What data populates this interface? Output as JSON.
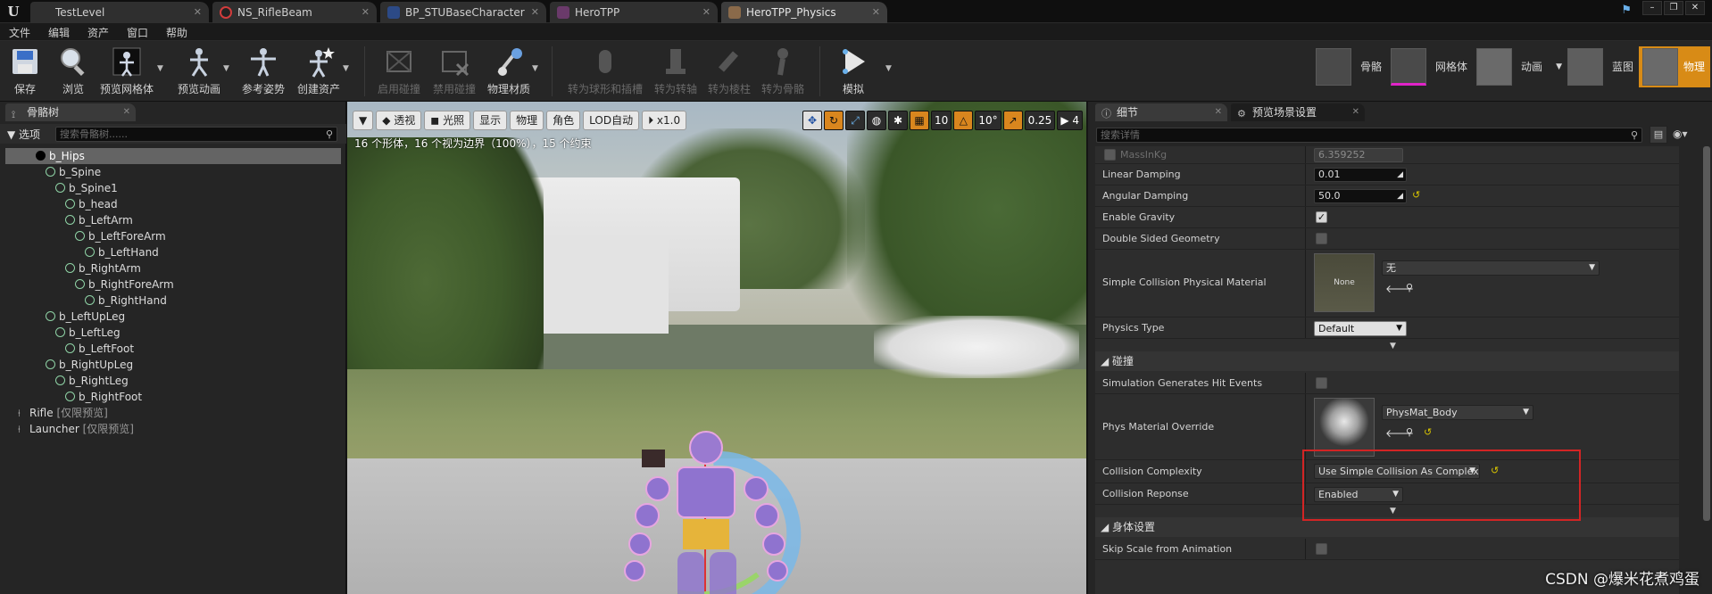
{
  "tabs": [
    {
      "label": "TestLevel"
    },
    {
      "label": "NS_RifleBeam"
    },
    {
      "label": "BP_STUBaseCharacter"
    },
    {
      "label": "HeroTPP"
    },
    {
      "label": "HeroTPP_Physics"
    }
  ],
  "menu": [
    "文件",
    "编辑",
    "资产",
    "窗口",
    "帮助"
  ],
  "toolbar": {
    "save": "保存",
    "browse": "浏览",
    "preview_mesh": "预览网格体",
    "preview_anim": "预览动画",
    "ref_pose": "参考姿势",
    "create_asset": "创建资产",
    "enable_collision": "启用碰撞",
    "disable_collision": "禁用碰撞",
    "phys_material": "物理材质",
    "to_sphyl": "转为球形和插槽",
    "to_axis": "转为转轴",
    "to_pillar": "转为棱柱",
    "to_bone": "转为骨骼",
    "simulate": "模拟"
  },
  "modes": {
    "skeleton": "骨骼",
    "mesh": "网格体",
    "animation": "动画",
    "blueprint": "蓝图",
    "physics": "物理"
  },
  "left_panel": {
    "tab": "骨骼树",
    "options": "选项",
    "search_placeholder": "搜索骨骼树......",
    "bones": [
      {
        "name": "b_Hips",
        "depth": 0,
        "root": true
      },
      {
        "name": "b_Spine",
        "depth": 1
      },
      {
        "name": "b_Spine1",
        "depth": 2
      },
      {
        "name": "b_head",
        "depth": 3
      },
      {
        "name": "b_LeftArm",
        "depth": 3
      },
      {
        "name": "b_LeftForeArm",
        "depth": 4
      },
      {
        "name": "b_LeftHand",
        "depth": 5
      },
      {
        "name": "b_RightArm",
        "depth": 3
      },
      {
        "name": "b_RightForeArm",
        "depth": 4
      },
      {
        "name": "b_RightHand",
        "depth": 5
      },
      {
        "name": "b_LeftUpLeg",
        "depth": 1
      },
      {
        "name": "b_LeftLeg",
        "depth": 2
      },
      {
        "name": "b_LeftFoot",
        "depth": 3
      },
      {
        "name": "b_RightUpLeg",
        "depth": 1
      },
      {
        "name": "b_RightLeg",
        "depth": 2
      },
      {
        "name": "b_RightFoot",
        "depth": 3
      }
    ],
    "sockets": [
      {
        "name": "Rifle",
        "suffix": "[仅限预览]"
      },
      {
        "name": "Launcher",
        "suffix": "[仅限预览]"
      }
    ]
  },
  "viewport": {
    "perspective": "透视",
    "lit": "光照",
    "show": "显示",
    "physics": "物理",
    "character": "角色",
    "lod": "LOD自动",
    "speed": "x1.0",
    "info": "16 个形体，16 个视为边界（100%），15 个约束",
    "grid_snap": "10",
    "rot_snap": "10°",
    "scale_snap": "0.25",
    "cam_speed": "4"
  },
  "right_panel": {
    "tab_details": "细节",
    "tab_preview": "预览场景设置",
    "search_placeholder": "搜索详情",
    "mass_label": "MassInKg",
    "mass_value": "6.359252",
    "linear_damping_label": "Linear Damping",
    "linear_damping_value": "0.01",
    "angular_damping_label": "Angular Damping",
    "angular_damping_value": "50.0",
    "enable_gravity_label": "Enable Gravity",
    "double_sided_label": "Double Sided Geometry",
    "simple_coll_mat_label": "Simple Collision Physical Material",
    "simple_coll_mat_thumb": "None",
    "simple_coll_mat_value": "无",
    "physics_type_label": "Physics Type",
    "physics_type_value": "Default",
    "section_collision": "碰撞",
    "sim_hit_label": "Simulation Generates Hit Events",
    "phys_mat_override_label": "Phys Material Override",
    "phys_mat_override_value": "PhysMat_Body",
    "coll_complexity_label": "Collision Complexity",
    "coll_complexity_value": "Use Simple Collision As Complex",
    "coll_response_label": "Collision Reponse",
    "coll_response_value": "Enabled",
    "section_body": "身体设置",
    "skip_scale_label": "Skip Scale from Animation"
  },
  "watermark": "CSDN @爆米花煮鸡蛋"
}
